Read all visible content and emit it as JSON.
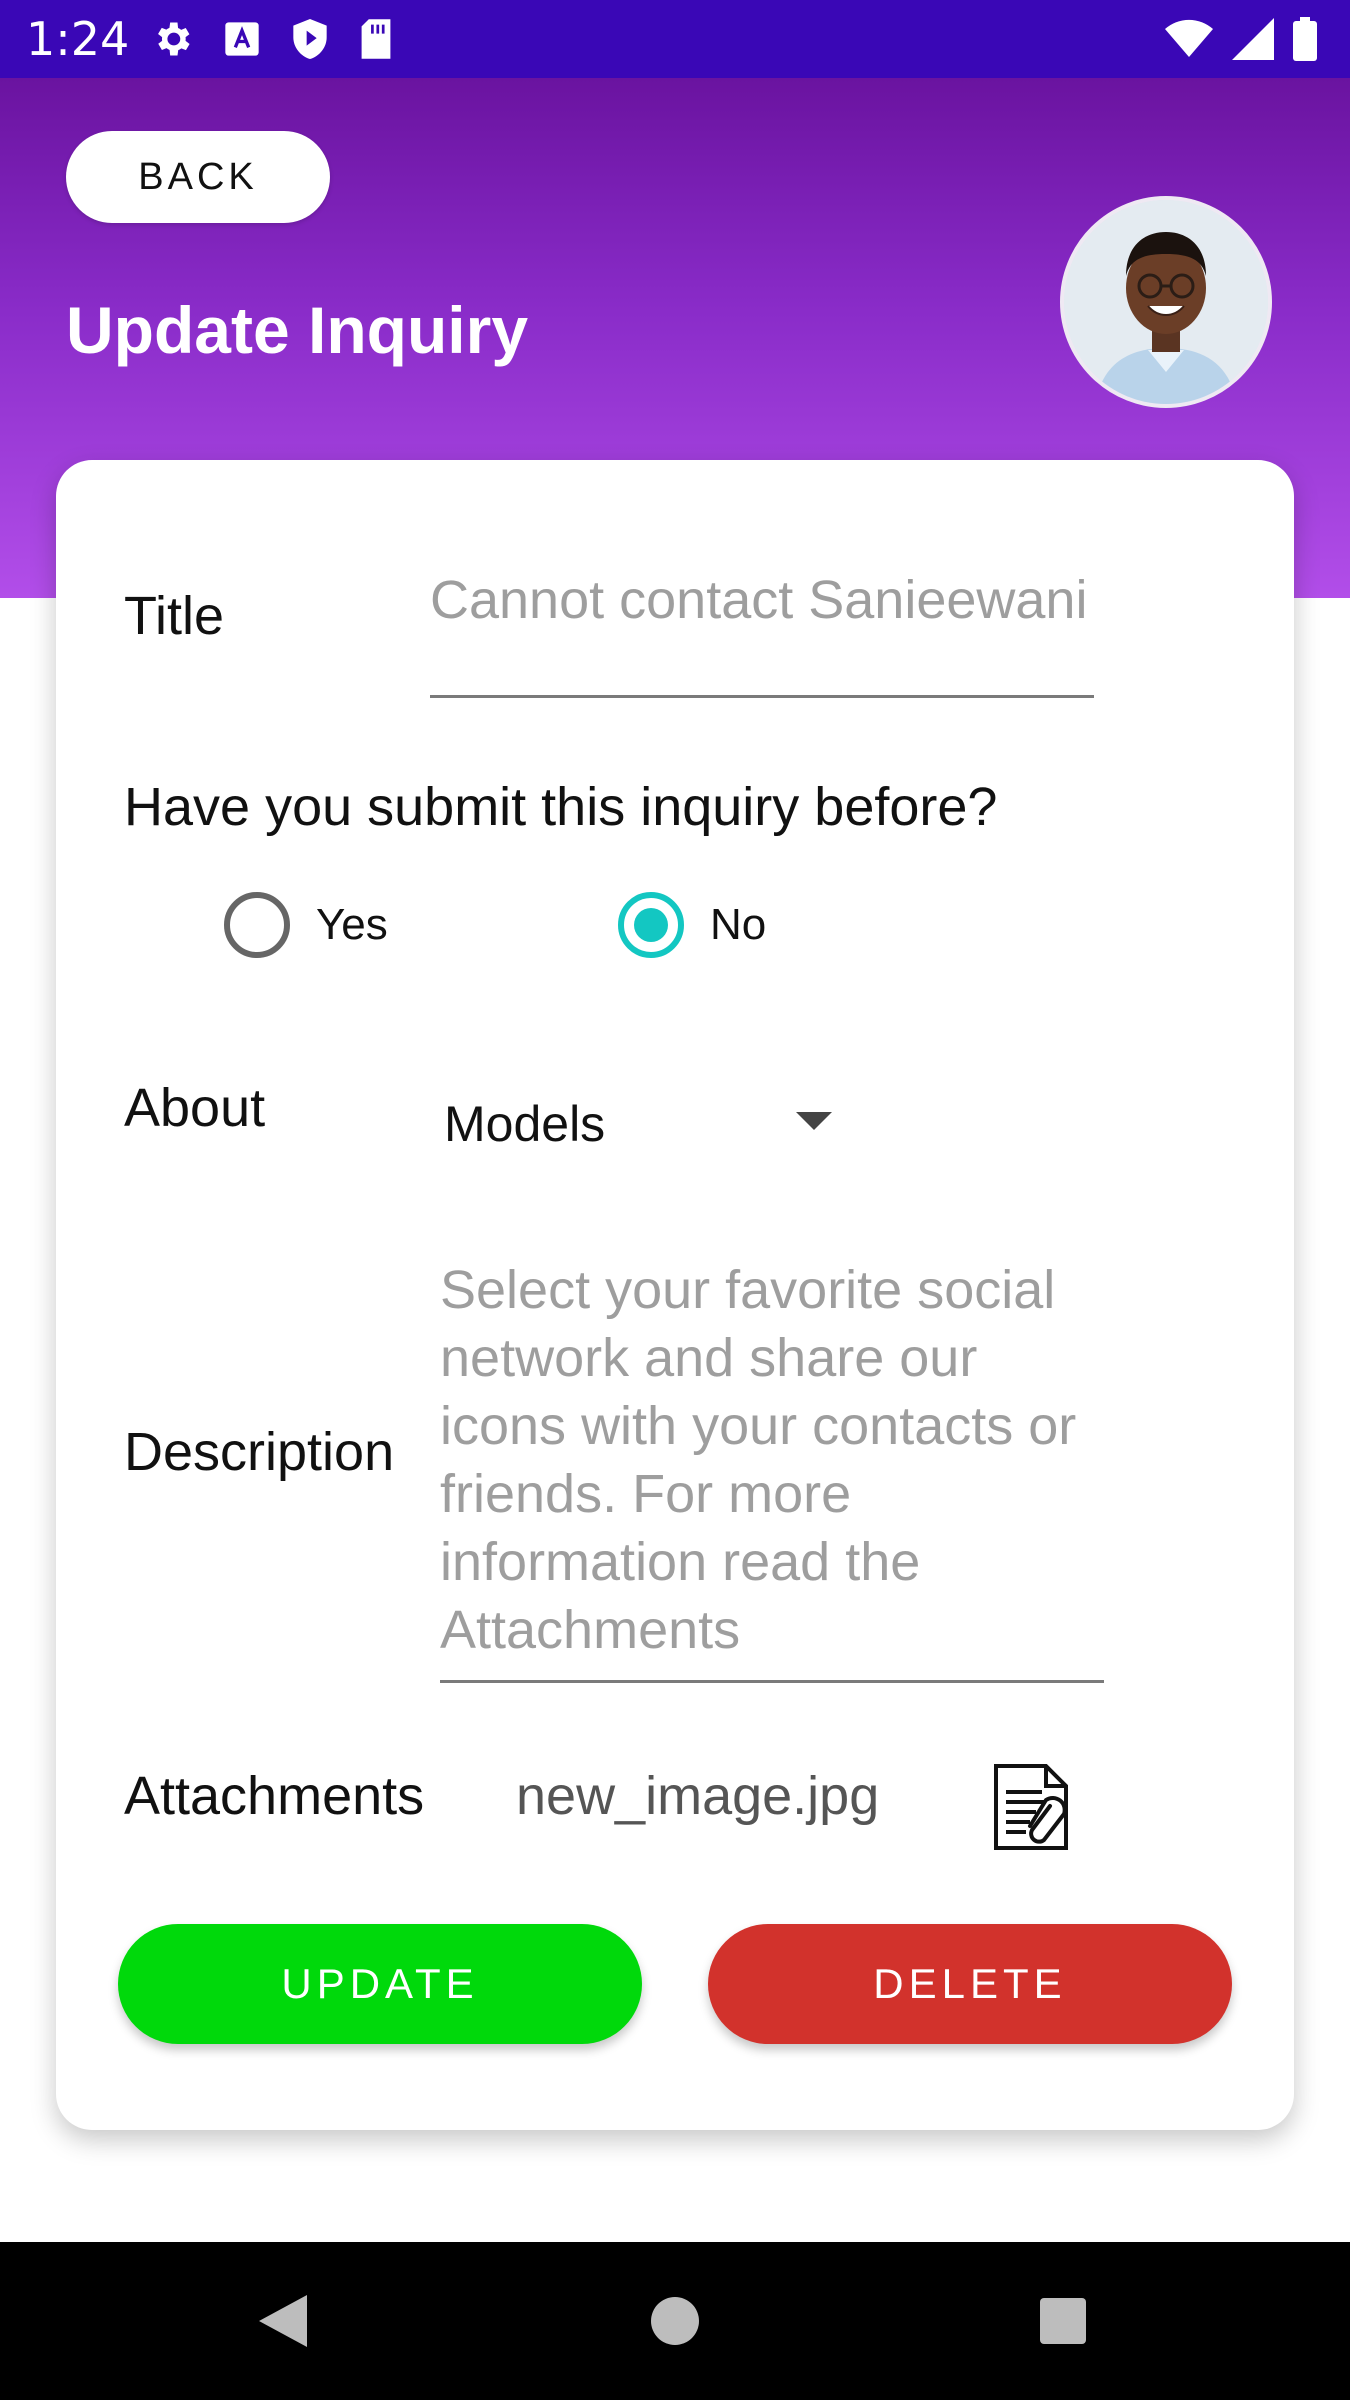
{
  "status_bar": {
    "time": "1:24",
    "left_icons": [
      "settings-icon",
      "a-icon",
      "shield-play-icon",
      "sd-card-icon"
    ],
    "right_icons": [
      "wifi-icon",
      "cell-signal-icon",
      "battery-icon"
    ]
  },
  "header": {
    "back_label": "BACK",
    "title": "Update Inquiry",
    "avatar": "user-avatar",
    "gradient_top": "#6a13a0",
    "gradient_bottom": "#b24ee9"
  },
  "form": {
    "title_label": "Title",
    "title_value": "Cannot contact Sanieewani",
    "question": "Have you submit this inquiry before?",
    "radio_yes": {
      "label": "Yes",
      "checked": false
    },
    "radio_no": {
      "label": "No",
      "checked": true
    },
    "about_label": "About",
    "about_value": "Models",
    "description_label": "Description",
    "description_value": "Select your favorite social network and share our icons with your contacts or friends. For more information read the Attachments",
    "attachments_label": "Attachments",
    "attachment_file": "new_image.jpg",
    "attachment_icon": "document-paperclip-icon"
  },
  "actions": {
    "update_label": "UPDATE",
    "delete_label": "DELETE",
    "update_color": "#00d90b",
    "delete_color": "#d2322c"
  },
  "nav_bar": {
    "icons": [
      "back-triangle-icon",
      "home-circle-icon",
      "recents-square-icon"
    ]
  }
}
